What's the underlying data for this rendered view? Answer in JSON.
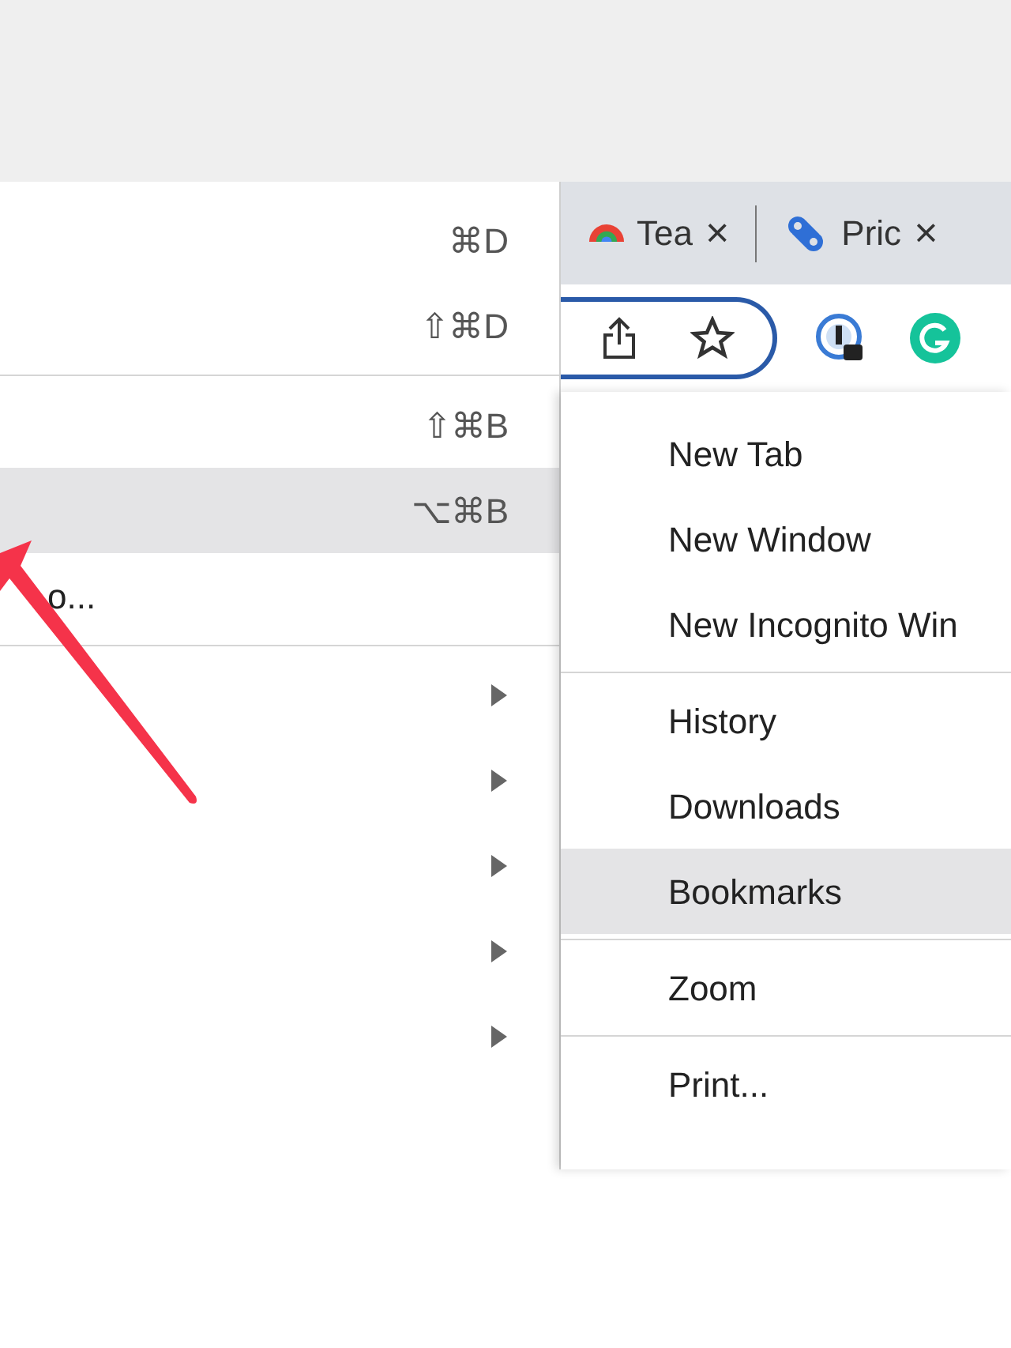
{
  "bookmarks_submenu": {
    "items": [
      {
        "kind": "shortcut",
        "shortcut": "⌘D",
        "highlighted": false
      },
      {
        "kind": "shortcut",
        "shortcut": "⇧⌘D",
        "highlighted": false
      },
      {
        "kind": "divider"
      },
      {
        "kind": "shortcut",
        "shortcut": "⇧⌘B",
        "highlighted": false
      },
      {
        "kind": "shortcut",
        "shortcut": "⌥⌘B",
        "highlighted": true
      },
      {
        "kind": "text",
        "label": "o...",
        "highlighted": false
      },
      {
        "kind": "divider"
      },
      {
        "kind": "submenu",
        "highlighted": false
      },
      {
        "kind": "submenu",
        "highlighted": false
      },
      {
        "kind": "submenu",
        "highlighted": false
      },
      {
        "kind": "submenu",
        "highlighted": false
      },
      {
        "kind": "submenu",
        "highlighted": false
      }
    ]
  },
  "tabs": [
    {
      "title": "Tea",
      "close": "×"
    },
    {
      "title": "Pric",
      "close": "×"
    }
  ],
  "chrome_menu": {
    "items": [
      {
        "kind": "item",
        "label": "New Tab",
        "highlighted": false
      },
      {
        "kind": "item",
        "label": "New Window",
        "highlighted": false
      },
      {
        "kind": "item",
        "label": "New Incognito Win",
        "highlighted": false
      },
      {
        "kind": "divider"
      },
      {
        "kind": "item",
        "label": "History",
        "highlighted": false
      },
      {
        "kind": "item",
        "label": "Downloads",
        "highlighted": false
      },
      {
        "kind": "item",
        "label": "Bookmarks",
        "highlighted": true
      },
      {
        "kind": "divider"
      },
      {
        "kind": "item",
        "label": "Zoom",
        "highlighted": false
      },
      {
        "kind": "divider"
      },
      {
        "kind": "item",
        "label": "Print...",
        "highlighted": false
      }
    ]
  }
}
